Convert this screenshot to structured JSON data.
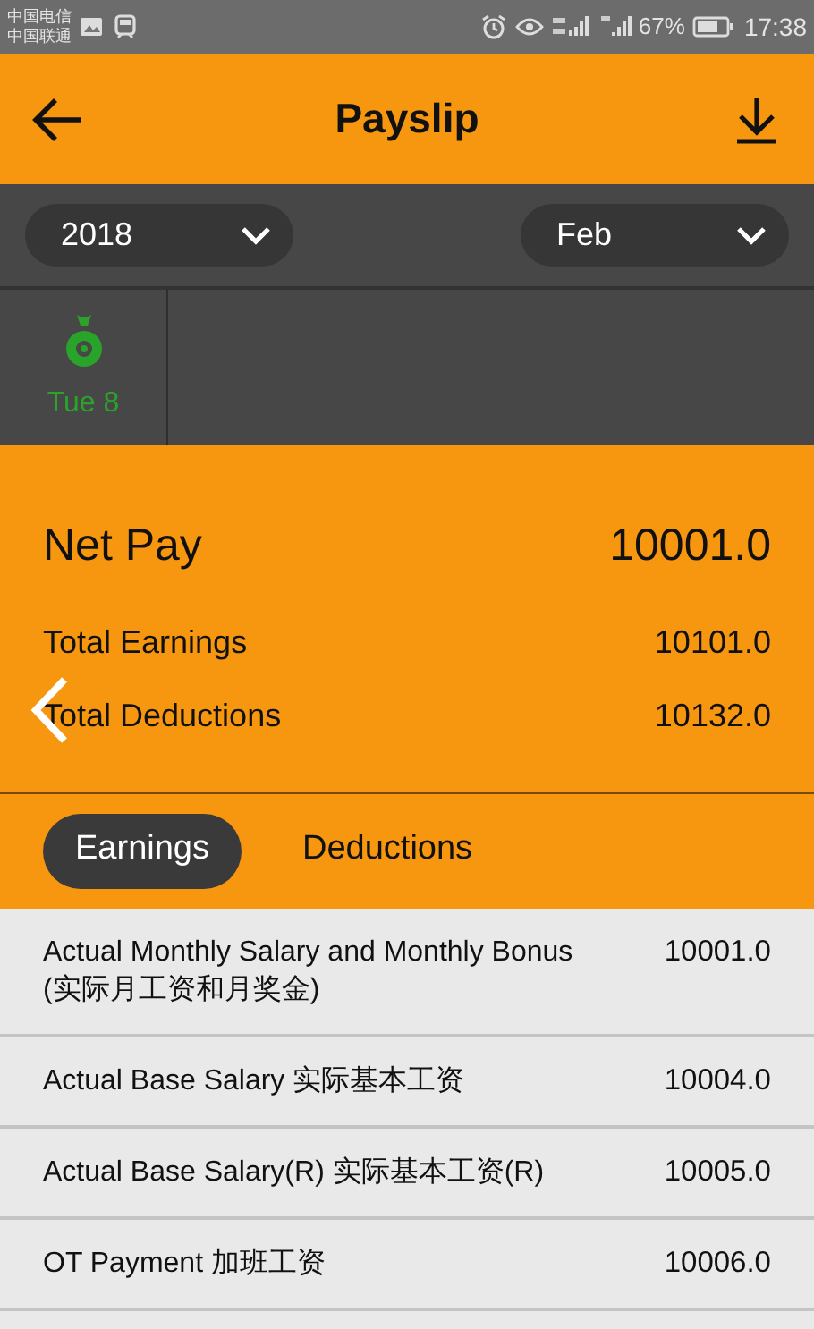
{
  "status_bar": {
    "carriers": [
      "中国电信",
      "中国联通"
    ],
    "battery": "67%",
    "time": "17:38"
  },
  "header": {
    "title": "Payslip"
  },
  "filters": {
    "year": "2018",
    "month": "Feb"
  },
  "days": [
    {
      "label": "Tue 8",
      "selected": true
    }
  ],
  "summary": {
    "net_pay_label": "Net Pay",
    "net_pay": "10001.0",
    "rows": [
      {
        "label": "Total Earnings",
        "value": "10101.0"
      },
      {
        "label": "Total Deductions",
        "value": "10132.0"
      }
    ]
  },
  "tabs": [
    {
      "label": "Earnings",
      "selected": true
    },
    {
      "label": "Deductions",
      "selected": false
    }
  ],
  "items": [
    {
      "label": "Actual Monthly Salary and Monthly Bonus\n(实际月工资和月奖金)",
      "value": "10001.0"
    },
    {
      "label": "Actual Base Salary 实际基本工资",
      "value": "10004.0"
    },
    {
      "label": "Actual Base Salary(R) 实际基本工资(R)",
      "value": "10005.0"
    },
    {
      "label": "OT Payment 加班工资",
      "value": "10006.0"
    }
  ]
}
